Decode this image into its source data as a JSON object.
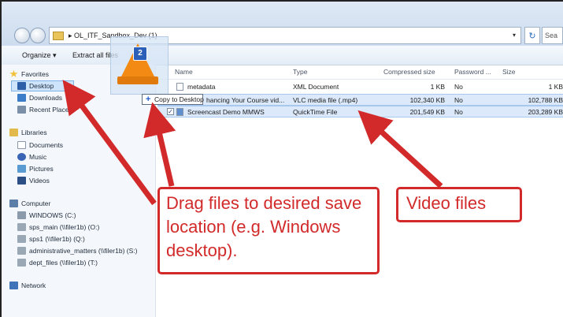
{
  "window": {
    "breadcrumb": "▸ OL_ITF_Sandbox_Dev (1)",
    "search_placeholder": "Sea"
  },
  "toolbar": {
    "organize_label": "Organize ▾",
    "extract_label": "Extract all files"
  },
  "sidebar": {
    "favorites": {
      "label": "Favorites",
      "items": [
        {
          "label": "Desktop",
          "icon": "desktop-icon"
        },
        {
          "label": "Downloads",
          "icon": "downloads-icon"
        },
        {
          "label": "Recent Places",
          "icon": "recent-places-icon"
        }
      ]
    },
    "libraries": {
      "label": "Libraries",
      "items": [
        {
          "label": "Documents",
          "icon": "documents-icon"
        },
        {
          "label": "Music",
          "icon": "music-icon"
        },
        {
          "label": "Pictures",
          "icon": "pictures-icon"
        },
        {
          "label": "Videos",
          "icon": "videos-icon"
        }
      ]
    },
    "computer": {
      "label": "Computer",
      "items": [
        {
          "label": "WINDOWS (C:)",
          "icon": "drive-icon"
        },
        {
          "label": "sps_main (\\\\filer1b) (O:)",
          "icon": "network-drive-icon"
        },
        {
          "label": "sps1 (\\\\filer1b) (Q:)",
          "icon": "network-drive-icon"
        },
        {
          "label": "administrative_matters (\\\\filer1b) (S:)",
          "icon": "network-drive-icon"
        },
        {
          "label": "dept_files (\\\\filer1b) (T:)",
          "icon": "network-drive-icon"
        }
      ]
    },
    "network": {
      "label": "Network"
    }
  },
  "columns": {
    "name": "Name",
    "type": "Type",
    "compressed": "Compressed size",
    "password": "Password ...",
    "size": "Size"
  },
  "files": [
    {
      "name": "metadata",
      "type": "XML Document",
      "compressed": "1 KB",
      "password": "No",
      "size": "1 KB"
    },
    {
      "name": "hancing Your Course vid...",
      "type": "VLC media file (.mp4)",
      "compressed": "102,340 KB",
      "password": "No",
      "size": "102,788 KB"
    },
    {
      "name": "Screencast Demo MMWS",
      "type": "QuickTime File",
      "compressed": "201,549 KB",
      "password": "No",
      "size": "203,289 KB"
    }
  ],
  "drag": {
    "badge": "2",
    "copy_tip": "Copy to Desktop"
  },
  "callouts": {
    "drag_text": "Drag files to desired save location (e.g. Windows desktop).",
    "video_text": "Video files"
  },
  "colors": {
    "callout_red": "#d22a2a",
    "selection_blue": "#cde4fb"
  }
}
